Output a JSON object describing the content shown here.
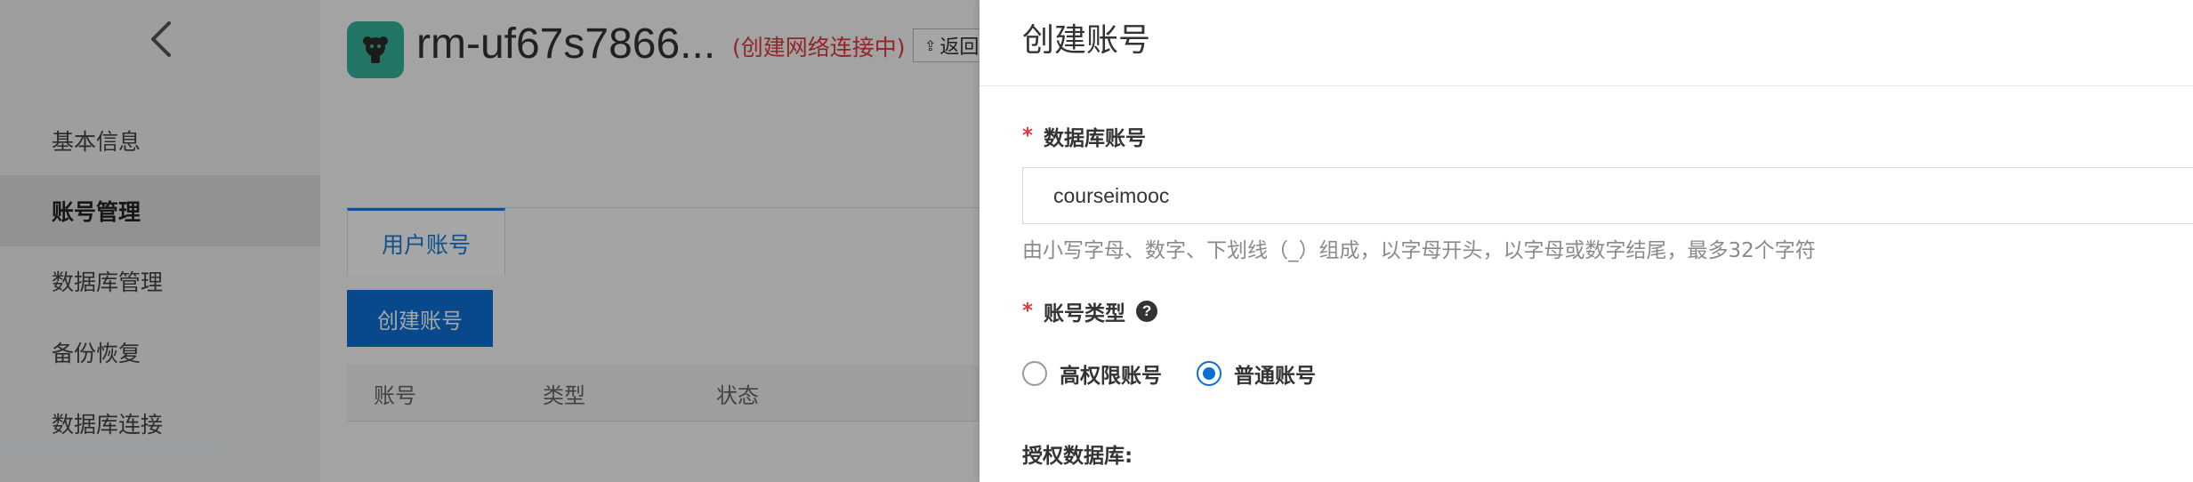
{
  "background": {
    "sidebar": {
      "back_icon": "chevron-left-icon",
      "items": [
        {
          "label": "基本信息",
          "active": false
        },
        {
          "label": "账号管理",
          "active": true
        },
        {
          "label": "数据库管理",
          "active": false
        },
        {
          "label": "备份恢复",
          "active": false
        },
        {
          "label": "数据库连接",
          "active": false
        }
      ]
    },
    "header": {
      "instance_name": "rm-uf67s7866...",
      "instance_status": "(创建网络连接中)",
      "return_label": "返回",
      "return_icon": "upload-arrow-icon",
      "logo_icon": "database-instance-logo"
    },
    "tabs": [
      {
        "label": "用户账号"
      }
    ],
    "create_button_label": "创建账号",
    "table_headers": [
      "账号",
      "类型",
      "状态"
    ]
  },
  "panel": {
    "title": "创建账号",
    "db_account": {
      "label": "数据库账号",
      "required_mark": "*",
      "value": "courseimooc",
      "hint": "由小写字母、数字、下划线（_）组成，以字母开头，以字母或数字结尾，最多32个字符"
    },
    "account_type": {
      "label": "账号类型",
      "required_mark": "*",
      "help_icon": "question-circle-icon",
      "options": [
        {
          "label": "高权限账号",
          "checked": false
        },
        {
          "label": "普通账号",
          "checked": true
        }
      ]
    },
    "authorized_db": {
      "label": "授权数据库:"
    }
  },
  "colors": {
    "accent": "#0b70d6",
    "required": "#e0393e",
    "status_text": "#e0393e",
    "instance_logo": "#35b49a"
  }
}
